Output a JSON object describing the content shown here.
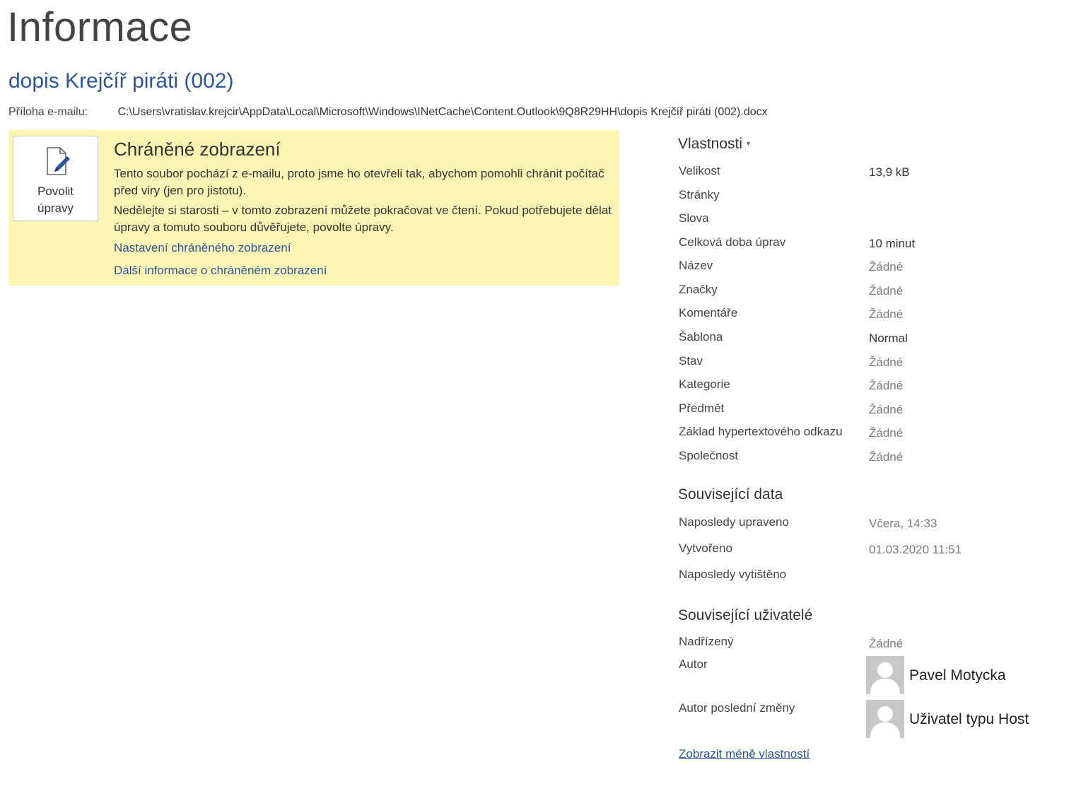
{
  "page": {
    "title": "Informace",
    "doc_title": "dopis Krejčíř piráti (002)",
    "path_label": "Příloha e-mailu:",
    "path_value": "C:\\Users\\vratislav.krejcir\\AppData\\Local\\Microsoft\\Windows\\INetCache\\Content.Outlook\\9Q8R29HH\\dopis Krejčíř piráti (002).docx"
  },
  "protected_view": {
    "button_label": "Povolit\núpravy",
    "title": "Chráněné zobrazení",
    "text1": "Tento soubor pochází z e-mailu, proto jsme ho otevřeli tak, abychom pomohli chránit počítač před viry (jen pro jistotu).",
    "text2": "Nedělejte si starosti – v tomto zobrazení můžete pokračovat ve čtení. Pokud potřebujete dělat úpravy a tomuto souboru důvěřujete, povolte úpravy.",
    "link1": "Nastavení chráněného zobrazení",
    "link2": "Další informace o chráněném zobrazení",
    "background_color": "#fcf4b4"
  },
  "properties": {
    "header": "Vlastnosti",
    "rows": [
      {
        "label": "Velikost",
        "value": "13,9 kB"
      },
      {
        "label": "Stránky",
        "value": ""
      },
      {
        "label": "Slova",
        "value": ""
      },
      {
        "label": "Celková doba úprav",
        "value": "10 minut"
      },
      {
        "label": "Název",
        "value": "Žádné"
      },
      {
        "label": "Značky",
        "value": "Žádné"
      },
      {
        "label": "Komentáře",
        "value": "Žádné"
      },
      {
        "label": "Šablona",
        "value": "Normal"
      },
      {
        "label": "Stav",
        "value": "Žádné"
      },
      {
        "label": "Kategorie",
        "value": "Žádné"
      },
      {
        "label": "Předmět",
        "value": "Žádné"
      },
      {
        "label": "Základ hypertextového odkazu",
        "value": "Žádné"
      },
      {
        "label": "Společnost",
        "value": "Žádné"
      }
    ]
  },
  "related_dates": {
    "header": "Související data",
    "rows": [
      {
        "label": "Naposledy upraveno",
        "value": "Včera, 14:33"
      },
      {
        "label": "Vytvořeno",
        "value": "01.03.2020 11:51"
      },
      {
        "label": "Naposledy vytištěno",
        "value": ""
      }
    ]
  },
  "related_people": {
    "header": "Související uživatelé",
    "manager_label": "Nadřízený",
    "manager_value": "Žádné",
    "author_label": "Autor",
    "author_name": "Pavel Motycka",
    "last_modified_label": "Autor poslední změny",
    "last_modified_name": "Uživatel typu Host"
  },
  "show_less_link": "Zobrazit méně vlastností",
  "colors": {
    "accent": "#2b579a",
    "text": "#444444",
    "muted": "#7a7a7a"
  }
}
